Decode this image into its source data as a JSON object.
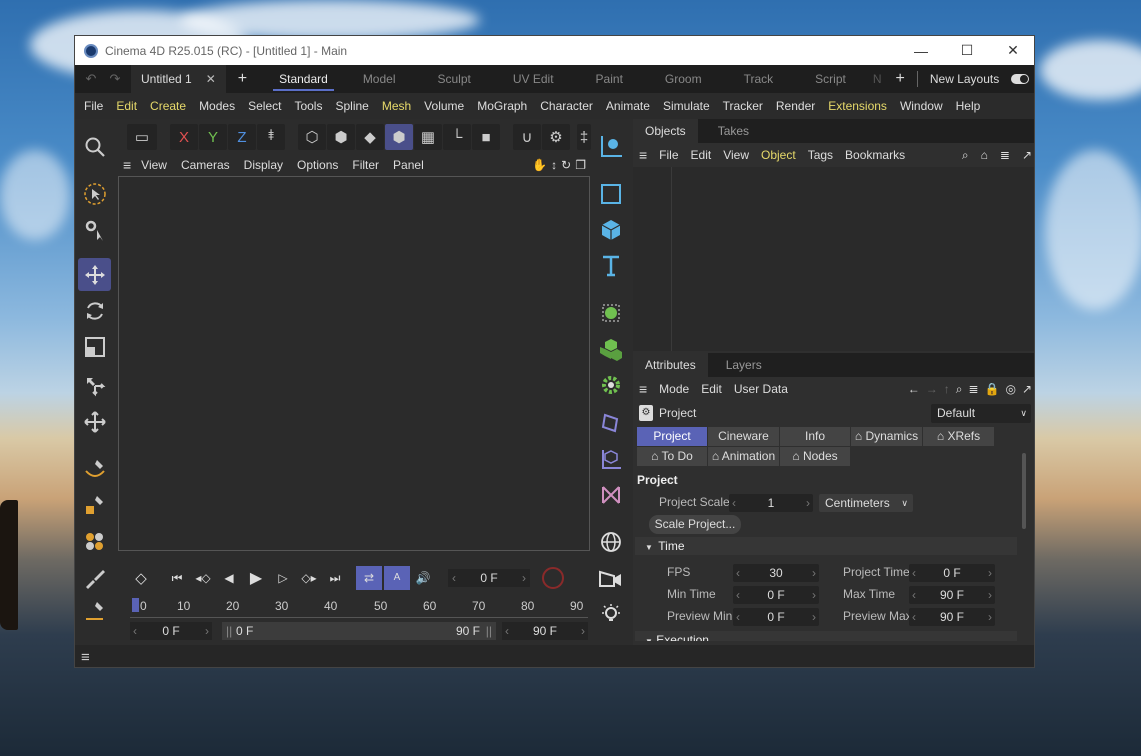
{
  "window": {
    "title": "Cinema 4D R25.015 (RC) - [Untitled 1] - Main"
  },
  "doc_tab": {
    "label": "Untitled 1"
  },
  "layouts": [
    "Standard",
    "Model",
    "Sculpt",
    "UV Edit",
    "Paint",
    "Groom",
    "Track",
    "Script",
    "N"
  ],
  "new_layouts": "New Layouts",
  "menu": [
    "File",
    "Edit",
    "Create",
    "Modes",
    "Select",
    "Tools",
    "Spline",
    "Mesh",
    "Volume",
    "MoGraph",
    "Character",
    "Animate",
    "Simulate",
    "Tracker",
    "Render",
    "Extensions",
    "Window",
    "Help"
  ],
  "viewport_menu": [
    "View",
    "Cameras",
    "Display",
    "Options",
    "Filter",
    "Panel"
  ],
  "axis_buttons": [
    "X",
    "Y",
    "Z"
  ],
  "objects_panel": {
    "tabs": [
      "Objects",
      "Takes"
    ],
    "menu": [
      "File",
      "Edit",
      "View",
      "Object",
      "Tags",
      "Bookmarks"
    ]
  },
  "attributes_panel": {
    "tabs": [
      "Attributes",
      "Layers"
    ],
    "menu": [
      "Mode",
      "Edit",
      "User Data"
    ],
    "header": "Project",
    "dropdown": "Default",
    "tabs_row1": [
      "Project",
      "Cineware",
      "Info",
      "Dynamics",
      "XRefs"
    ],
    "tabs_row2": [
      "To Do",
      "Animation",
      "Nodes"
    ],
    "section_title": "Project",
    "project_scale_label": "Project Scale",
    "project_scale_value": "1",
    "unit": "Centimeters",
    "scale_button": "Scale Project...",
    "time_section": "Time",
    "fps_label": "FPS",
    "fps_value": "30",
    "project_time_label": "Project Time",
    "project_time_value": "0 F",
    "min_time_label": "Min Time",
    "min_time_value": "0 F",
    "max_time_label": "Max Time",
    "max_time_value": "90 F",
    "preview_min_label": "Preview Min",
    "preview_min_value": "0 F",
    "preview_max_label": "Preview Max",
    "preview_max_value": "90 F",
    "next_section": "Execution"
  },
  "timeline": {
    "current_frame": "0 F",
    "ruler": [
      "0",
      "10",
      "20",
      "30",
      "40",
      "50",
      "60",
      "70",
      "80",
      "90"
    ],
    "start_field": "0 F",
    "range_start": "0 F",
    "range_end": "90 F",
    "end_field": "90 F"
  }
}
